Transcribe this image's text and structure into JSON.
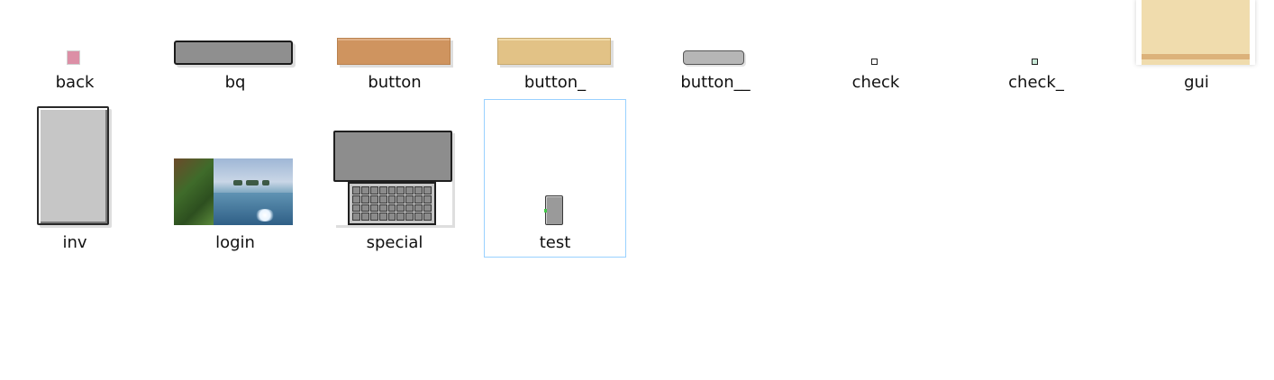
{
  "files": [
    {
      "id": "back",
      "name": "back"
    },
    {
      "id": "bq",
      "name": "bq"
    },
    {
      "id": "button",
      "name": "button"
    },
    {
      "id": "button2",
      "name": "button_"
    },
    {
      "id": "button3",
      "name": "button__"
    },
    {
      "id": "check",
      "name": "check"
    },
    {
      "id": "check2",
      "name": "check_"
    },
    {
      "id": "gui",
      "name": "gui"
    },
    {
      "id": "inv",
      "name": "inv"
    },
    {
      "id": "login",
      "name": "login"
    },
    {
      "id": "special",
      "name": "special"
    },
    {
      "id": "test",
      "name": "test",
      "selected": true
    }
  ],
  "colors": {
    "selection_border": "#99d1ff",
    "label_text": "#111111",
    "background": "#ffffff"
  }
}
